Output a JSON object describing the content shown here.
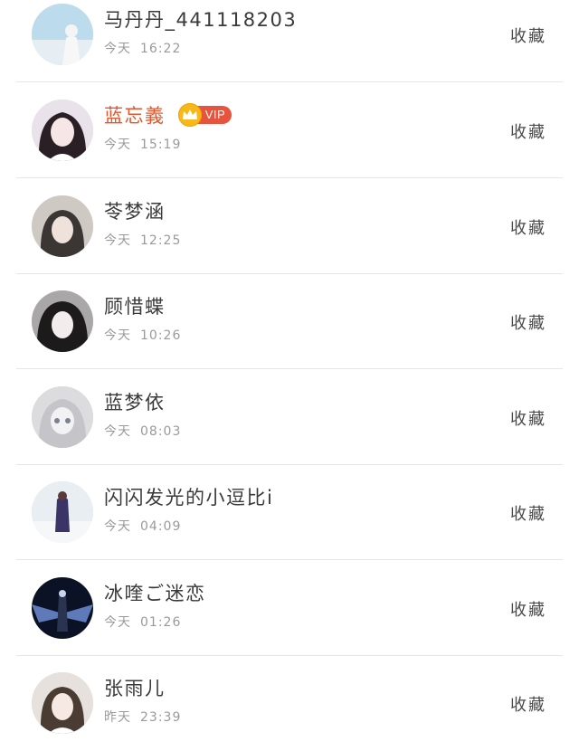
{
  "favorite_label": "收藏",
  "users": [
    {
      "name": "马丹丹_441118203",
      "day": "今天",
      "time": "16:22",
      "vip": false
    },
    {
      "name": "蓝忘義",
      "day": "今天",
      "time": "15:19",
      "vip": true,
      "vip_label": "VIP"
    },
    {
      "name": "苓梦涵",
      "day": "今天",
      "time": "12:25",
      "vip": false
    },
    {
      "name": "顾惜蝶",
      "day": "今天",
      "time": "10:26",
      "vip": false
    },
    {
      "name": "蓝梦依",
      "day": "今天",
      "time": "08:03",
      "vip": false
    },
    {
      "name": "闪闪发光的小逗比i",
      "day": "今天",
      "time": "04:09",
      "vip": false
    },
    {
      "name": "冰喹ご迷恋",
      "day": "今天",
      "time": "01:26",
      "vip": false
    },
    {
      "name": "张雨儿",
      "day": "昨天",
      "time": "23:39",
      "vip": false
    }
  ],
  "colors": {
    "vip_name": "#e4572e",
    "vip_tag": "#e8533d",
    "crown": "#f6b81a"
  }
}
